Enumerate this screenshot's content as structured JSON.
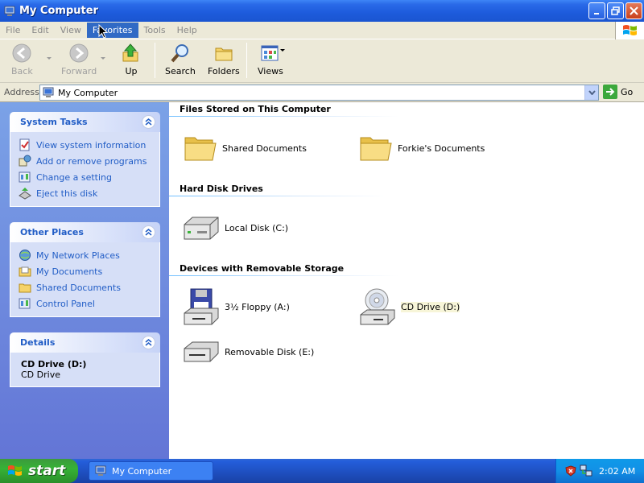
{
  "window": {
    "title": "My Computer"
  },
  "menu": [
    "File",
    "Edit",
    "View",
    "Favorites",
    "Tools",
    "Help"
  ],
  "menu_active": "Favorites",
  "toolbar": {
    "back": "Back",
    "forward": "Forward",
    "up": "Up",
    "search": "Search",
    "folders": "Folders",
    "views": "Views"
  },
  "address": {
    "label": "Address",
    "value": "My Computer",
    "go": "Go"
  },
  "system_tasks": {
    "title": "System Tasks",
    "items": [
      "View system information",
      "Add or remove programs",
      "Change a setting",
      "Eject this disk"
    ]
  },
  "other_places": {
    "title": "Other Places",
    "items": [
      "My Network Places",
      "My Documents",
      "Shared Documents",
      "Control Panel"
    ]
  },
  "details": {
    "title": "Details",
    "name": "CD Drive (D:)",
    "type": "CD Drive"
  },
  "groups": {
    "files": {
      "title": "Files Stored on This Computer",
      "items": [
        "Shared Documents",
        "Forkie's Documents"
      ]
    },
    "hdd": {
      "title": "Hard Disk Drives",
      "items": [
        "Local Disk (C:)"
      ]
    },
    "removable": {
      "title": "Devices with Removable Storage",
      "items": [
        "3½ Floppy (A:)",
        "CD Drive (D:)",
        "Removable Disk (E:)"
      ]
    }
  },
  "taskbar": {
    "start": "start",
    "task": "My Computer",
    "clock": "2:02 AM"
  },
  "colors": {
    "link": "#215dc6",
    "titlebar": "#1d5bdc",
    "panel": "#7ba2e7"
  }
}
